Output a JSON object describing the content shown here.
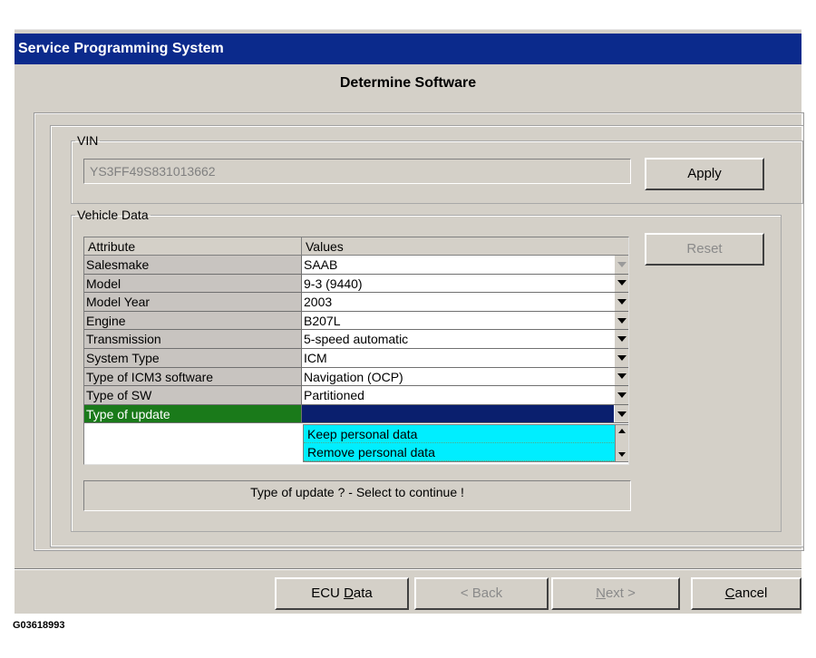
{
  "window": {
    "title": "Service Programming System",
    "heading": "Determine Software"
  },
  "vin_group": {
    "legend": "VIN",
    "vin_value": "YS3FF49S831013662",
    "apply_label": "Apply"
  },
  "vehicle_group": {
    "legend": "Vehicle Data",
    "reset_label": "Reset",
    "columns": [
      "Attribute",
      "Values"
    ],
    "rows": [
      {
        "attribute": "Salesmake",
        "value": "SAAB"
      },
      {
        "attribute": "Model",
        "value": "9-3 (9440)"
      },
      {
        "attribute": "Model Year",
        "value": "2003"
      },
      {
        "attribute": "Engine",
        "value": "B207L"
      },
      {
        "attribute": "Transmission",
        "value": "5-speed automatic"
      },
      {
        "attribute": "System Type",
        "value": "ICM"
      },
      {
        "attribute": "Type of ICM3 software",
        "value": "Navigation (OCP)"
      },
      {
        "attribute": "Type of SW",
        "value": "Partitioned"
      },
      {
        "attribute": "Type of update",
        "value": ""
      }
    ],
    "dropdown_options": [
      "Keep personal data",
      "Remove personal data"
    ],
    "status_message": "Type of update ? - Select to continue !"
  },
  "footer": {
    "ecu_data_pre": "ECU ",
    "ecu_data_ul": "D",
    "ecu_data_post": "ata",
    "back_label": "< Back",
    "next_ul": "N",
    "next_post": "ext >",
    "cancel_ul": "C",
    "cancel_post": "ancel"
  },
  "figure_id": "G03618993"
}
